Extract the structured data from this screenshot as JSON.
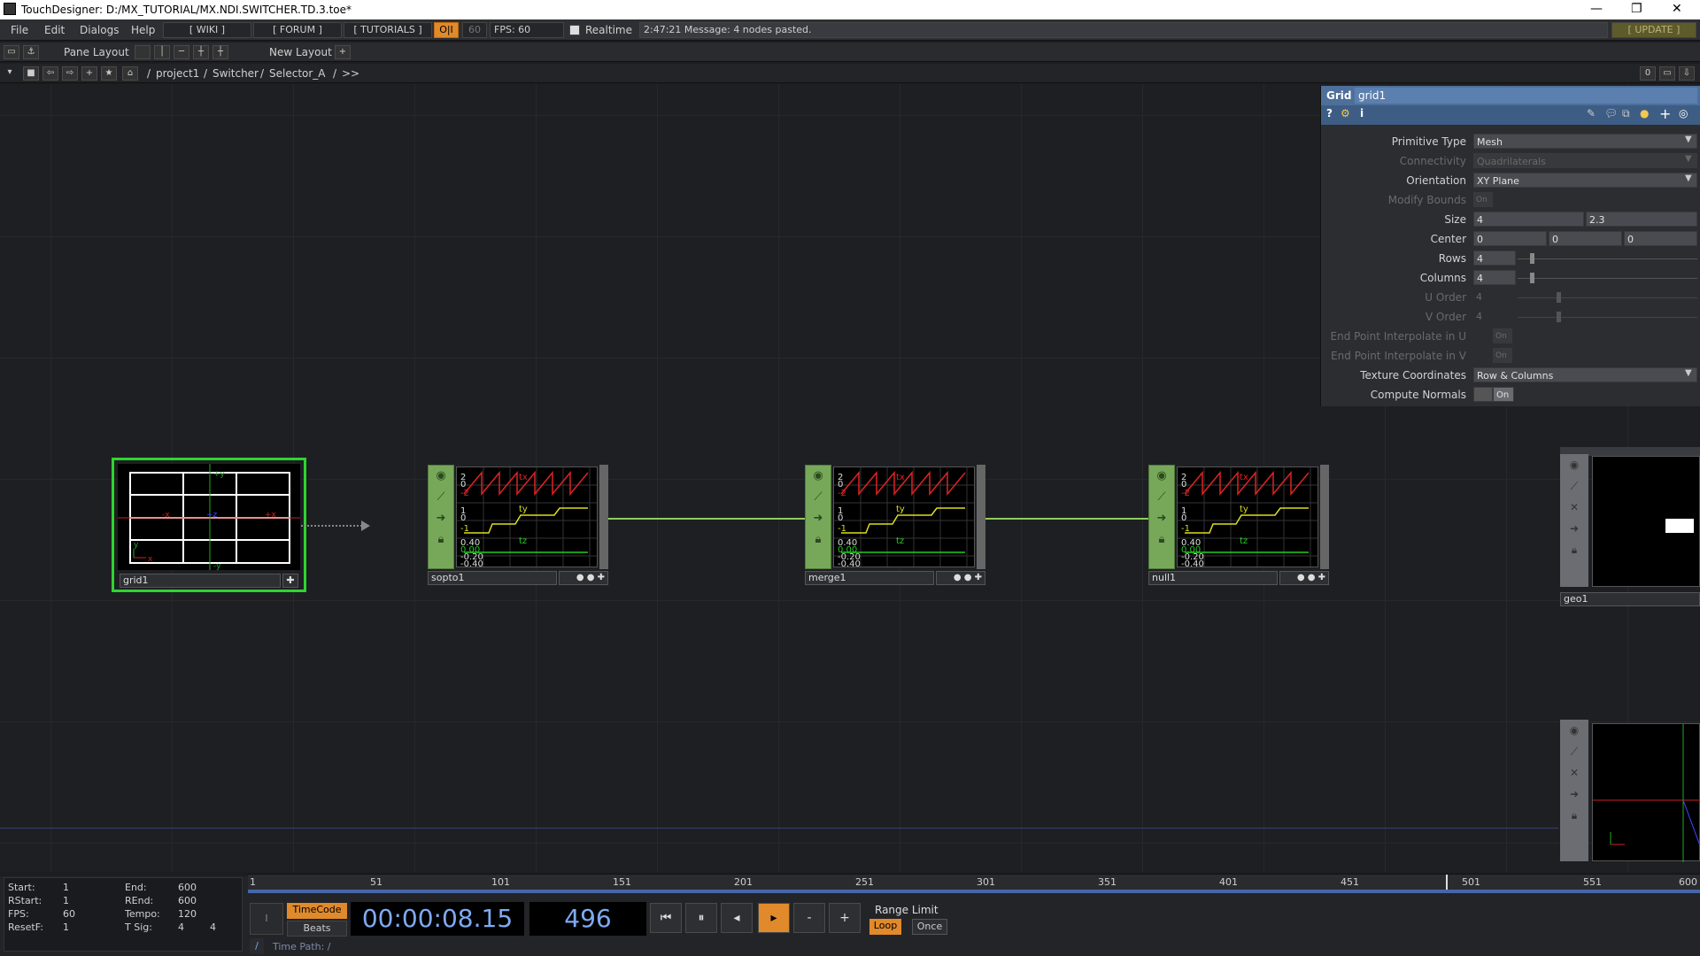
{
  "window": {
    "title": "TouchDesigner: D:/MX_TUTORIAL/MX.NDI.SWITCHER.TD.3.toe*",
    "minimize": "—",
    "restore": "❐",
    "close": "✕"
  },
  "menu": {
    "items": [
      "File",
      "Edit",
      "Dialogs",
      "Help"
    ],
    "wiki": "[ WIKI ]",
    "forum": "[ FORUM ]",
    "tutorials": "[ TUTORIALS ]",
    "perf": "O|I",
    "fps_cap": "60",
    "fps": "FPS:  60",
    "realtime": "Realtime",
    "message": "2:47:21 Message: 4 nodes pasted.",
    "update": "[ UPDATE ]"
  },
  "toolbar": {
    "pane_layout": "Pane Layout",
    "new_layout": "New Layout",
    "plus": "+"
  },
  "path": {
    "items": [
      "/",
      "project1",
      "/",
      "Switcher",
      "/",
      "Selector_A",
      "/",
      ">>"
    ],
    "counter": "0"
  },
  "nodes": {
    "grid1": "grid1",
    "sopto1": "sopto1",
    "merge1": "merge1",
    "null1": "null1",
    "geo1": "geo1",
    "chop_labels": {
      "v2": "2",
      "v0": "0",
      "v_2": "-2",
      "v1": "1",
      "v0b": "0",
      "v_1": "-1",
      "v040": "0.40",
      "v000": "0.00",
      "v_020": "-0.20",
      "v_040": "-0.40",
      "tx": "tx",
      "ty": "ty",
      "tz": "tz"
    },
    "grid_axes": {
      "py": "+y",
      "my": "-y",
      "px": "+x",
      "mx": "-x",
      "pz": "+z",
      "y": "y",
      "x": "x"
    }
  },
  "params": {
    "type": "Grid",
    "name": "grid1",
    "rows": [
      {
        "label": "Primitive Type",
        "value": "Mesh",
        "disabled": false
      },
      {
        "label": "Connectivity",
        "value": "Quadrilaterals",
        "disabled": true
      },
      {
        "label": "Orientation",
        "value": "XY Plane",
        "disabled": false
      },
      {
        "label": "Modify Bounds",
        "value": "On",
        "disabled": true
      },
      {
        "label": "Size",
        "values": [
          "4",
          "2.3"
        ],
        "disabled": false
      },
      {
        "label": "Center",
        "values": [
          "0",
          "0",
          "0"
        ],
        "disabled": false
      },
      {
        "label": "Rows",
        "value": "4",
        "disabled": false
      },
      {
        "label": "Columns",
        "value": "4",
        "disabled": false
      },
      {
        "label": "U Order",
        "value": "4",
        "disabled": true
      },
      {
        "label": "V Order",
        "value": "4",
        "disabled": true
      },
      {
        "label": "End Point Interpolate in U",
        "value": "On",
        "disabled": true
      },
      {
        "label": "End Point Interpolate in V",
        "value": "On",
        "disabled": true
      },
      {
        "label": "Texture Coordinates",
        "value": "Row & Columns",
        "disabled": false
      },
      {
        "label": "Compute Normals",
        "value": "On",
        "disabled": false
      }
    ]
  },
  "timeline": {
    "ticks": [
      "1",
      "51",
      "101",
      "151",
      "201",
      "251",
      "301",
      "351",
      "401",
      "451",
      "501",
      "551",
      "600"
    ],
    "current_frame_fraction": 0.825
  },
  "stats": {
    "start_label": "Start:",
    "start": "1",
    "end_label": "End:",
    "end": "600",
    "rstart_label": "RStart:",
    "rstart": "1",
    "rend_label": "REnd:",
    "rend": "600",
    "fps_label": "FPS:",
    "fps": "60",
    "tempo_label": "Tempo:",
    "tempo": "120",
    "resetf_label": "ResetF:",
    "resetf": "1",
    "tsig_label": "T Sig:",
    "tsig_a": "4",
    "tsig_b": "4"
  },
  "transport": {
    "timecode": "TimeCode",
    "beats": "Beats",
    "time": "00:00:08.15",
    "frame": "496",
    "range_limit": "Range Limit",
    "loop": "Loop",
    "once": "Once",
    "minus": "-",
    "plus": "+",
    "time_path": "Time Path: /",
    "i_label": "I",
    "slash": "/"
  },
  "colors": {
    "accent_orange": "#e08a2c",
    "node_green": "#77a85a",
    "wire_green": "#8ccf5c",
    "selected_green": "#2fd42f",
    "param_header": "#4d6f9a",
    "time_blue": "#7eaaf2"
  }
}
